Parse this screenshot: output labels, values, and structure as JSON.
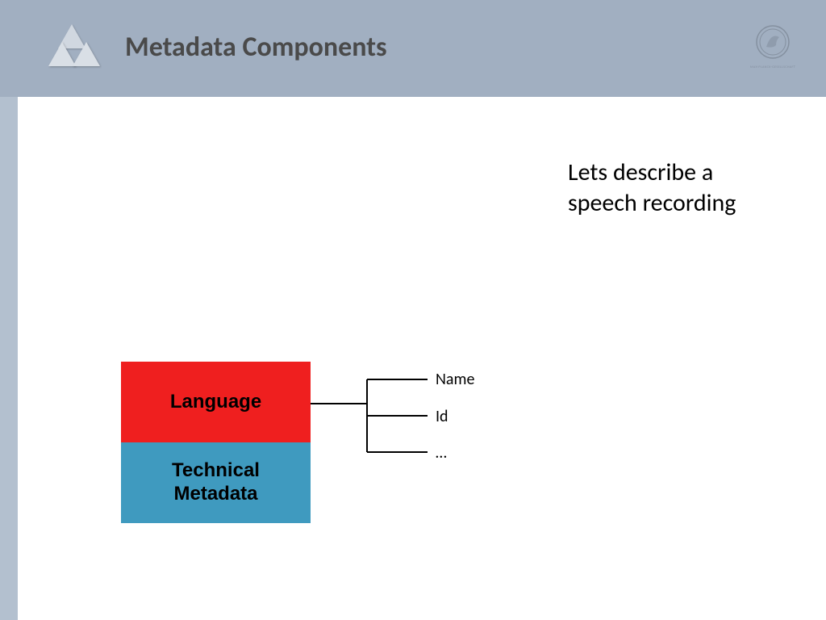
{
  "header": {
    "title": "Metadata Components",
    "seal_label": "MAX-PLANCK-GESELLSCHAFT"
  },
  "caption": "Lets describe a speech recording",
  "boxes": {
    "language_label": "Language",
    "technical_label": "Technical\nMetadata"
  },
  "branches": {
    "items": [
      "Name",
      "Id",
      "…"
    ]
  }
}
